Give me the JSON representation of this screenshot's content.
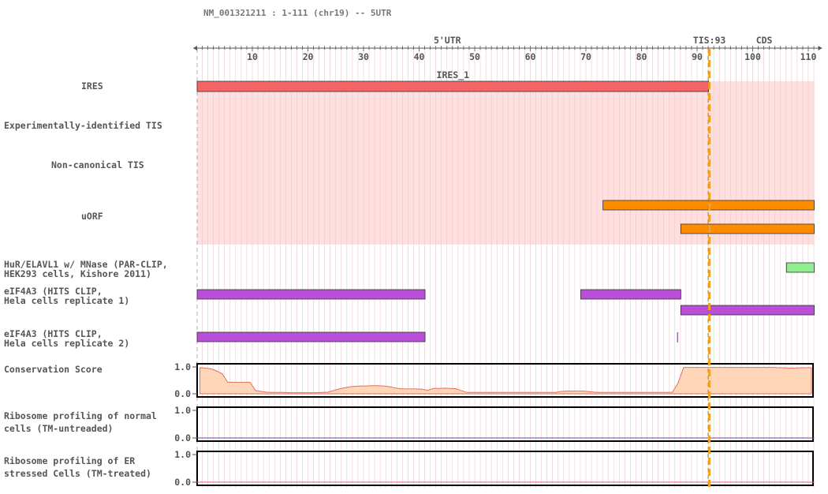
{
  "header": {
    "title": "NM_001321211 : 1-111 (chr19) -- 5UTR",
    "region_5utr": "5'UTR",
    "tis_label": "TIS:93",
    "cds_label": "CDS"
  },
  "colors": {
    "utr": "#e8000f",
    "tis": "#f5a020",
    "cds": "#1a7a1a",
    "ires": "#f46464",
    "ires_bg": "#ffdede",
    "uorf": "#ff8c00",
    "hur": "#90ee90",
    "eif4a3": "#b84fd6",
    "conservation_fill": "#ffd6b8",
    "conservation_line": "#e07060",
    "ribo_untreated": "#7b3fa0",
    "ribo_treated": "#e06080"
  },
  "axis": {
    "start": 1,
    "end": 111,
    "ticks": [
      10,
      20,
      30,
      40,
      50,
      60,
      70,
      80,
      90,
      100,
      110
    ],
    "tis_position": 93,
    "cds_start": 93
  },
  "tracks": [
    {
      "id": "ires",
      "label": "IRES"
    },
    {
      "id": "exp-tis",
      "label": "Experimentally-identified TIS"
    },
    {
      "id": "noncanon-tis",
      "label": "Non-canonical TIS"
    },
    {
      "id": "uorf",
      "label": "uORF"
    },
    {
      "id": "hur",
      "label": "HuR/ELAVL1 w/ MNase (PAR-CLIP,\nHEK293 cells, Kishore 2011)"
    },
    {
      "id": "eif4a3-1",
      "label": "eIF4A3 (HITS CLIP,\nHela cells replicate 1)"
    },
    {
      "id": "eif4a3-2",
      "label": "eIF4A3 (HITS CLIP,\nHela cells replicate 2)"
    },
    {
      "id": "conservation",
      "label": "Conservation Score"
    },
    {
      "id": "ribo-untreated",
      "label": "Ribosome profiling of normal\ncells (TM-untreaded)"
    },
    {
      "id": "ribo-treated",
      "label": "Ribosome profiling of ER\nstressed Cells (TM-treated)"
    }
  ],
  "ires": [
    {
      "start": 1,
      "end": 92,
      "name": "IRES_1"
    }
  ],
  "uorf": [
    {
      "start": 74,
      "end": 111
    },
    {
      "start": 88,
      "end": 111
    }
  ],
  "hur": [
    {
      "start": 107,
      "end": 111
    }
  ],
  "eif4a3_rep1": [
    {
      "start": 1,
      "end": 41,
      "row": 0
    },
    {
      "start": 70,
      "end": 87,
      "row": 0
    },
    {
      "start": 88,
      "end": 111,
      "row": 1
    }
  ],
  "eif4a3_rep2": [
    {
      "start": 1,
      "end": 41
    },
    {
      "start": 87,
      "end": 87
    }
  ],
  "score_axis": {
    "max_label": "1.0",
    "min_label": "0.0"
  },
  "chart_data": [
    {
      "type": "area",
      "title": "Conservation Score",
      "ylim": [
        0,
        1
      ],
      "x": [
        1,
        2,
        3,
        4,
        5,
        6,
        7,
        8,
        9,
        10,
        11,
        12,
        13,
        14,
        15,
        16,
        17,
        18,
        19,
        20,
        21,
        22,
        23,
        24,
        25,
        26,
        27,
        28,
        29,
        30,
        31,
        32,
        33,
        34,
        35,
        36,
        37,
        38,
        39,
        40,
        41,
        42,
        43,
        44,
        45,
        46,
        47,
        48,
        49,
        50,
        51,
        52,
        53,
        54,
        55,
        56,
        57,
        58,
        59,
        60,
        61,
        62,
        63,
        64,
        65,
        66,
        67,
        68,
        69,
        70,
        71,
        72,
        73,
        74,
        75,
        76,
        77,
        78,
        79,
        80,
        81,
        82,
        83,
        84,
        85,
        86,
        87,
        88,
        89,
        90,
        91,
        92,
        93,
        94,
        95,
        96,
        97,
        98,
        99,
        100,
        101,
        102,
        103,
        104,
        105,
        106,
        107,
        108,
        109,
        110,
        111
      ],
      "series": [
        {
          "values": [
            0.97,
            0.96,
            0.93,
            0.85,
            0.75,
            0.43,
            0.43,
            0.43,
            0.43,
            0.43,
            0.12,
            0.09,
            0.06,
            0.05,
            0.05,
            0.05,
            0.04,
            0.04,
            0.04,
            0.04,
            0.04,
            0.04,
            0.05,
            0.06,
            0.12,
            0.18,
            0.22,
            0.26,
            0.28,
            0.29,
            0.29,
            0.3,
            0.3,
            0.29,
            0.27,
            0.22,
            0.19,
            0.18,
            0.18,
            0.18,
            0.17,
            0.13,
            0.2,
            0.2,
            0.21,
            0.2,
            0.19,
            0.12,
            0.05,
            0.05,
            0.05,
            0.05,
            0.05,
            0.05,
            0.05,
            0.05,
            0.05,
            0.05,
            0.05,
            0.05,
            0.05,
            0.05,
            0.05,
            0.05,
            0.05,
            0.09,
            0.1,
            0.1,
            0.1,
            0.1,
            0.08,
            0.06,
            0.05,
            0.05,
            0.05,
            0.05,
            0.05,
            0.05,
            0.05,
            0.05,
            0.05,
            0.05,
            0.05,
            0.05,
            0.05,
            0.06,
            0.4,
            0.98,
            0.98,
            0.98,
            0.98,
            0.98,
            0.98,
            0.98,
            0.98,
            0.98,
            0.98,
            0.98,
            0.98,
            0.98,
            0.98,
            0.98,
            0.98,
            0.98,
            0.97,
            0.97,
            0.96,
            0.96,
            0.97,
            0.97,
            0.97
          ]
        }
      ]
    },
    {
      "type": "line",
      "title": "Ribosome profiling of normal cells (TM-untreaded)",
      "ylim": [
        0,
        1
      ],
      "x": [
        1,
        111
      ],
      "series": [
        {
          "values": [
            0,
            0
          ]
        }
      ]
    },
    {
      "type": "line",
      "title": "Ribosome profiling of ER stressed Cells (TM-treated)",
      "ylim": [
        0,
        1
      ],
      "x": [
        1,
        111
      ],
      "series": [
        {
          "values": [
            0,
            0
          ]
        }
      ]
    }
  ]
}
